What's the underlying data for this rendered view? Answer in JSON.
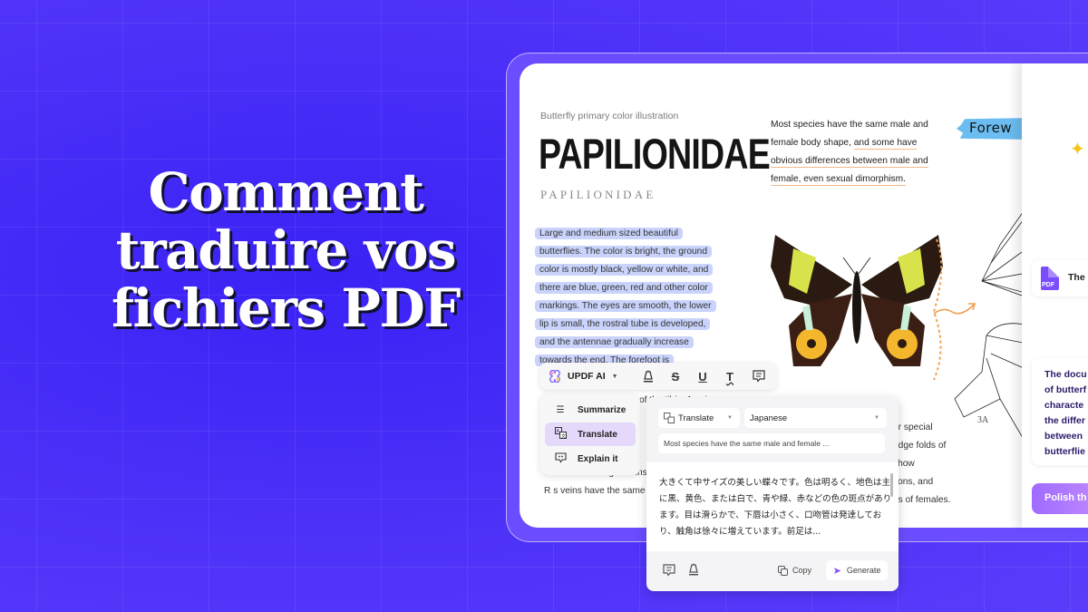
{
  "headline": {
    "lines": [
      "Comment",
      "traduire vos",
      "fichiers PDF"
    ]
  },
  "document": {
    "caption": "Butterfly primary color illustration",
    "title": "PAPILIONIDAE",
    "title_spaced": "PAPILIONIDAE",
    "left_paragraph_highlighted": [
      "Large and medium sized beautiful",
      "butterflies. The color is bright, the ground",
      "color is mostly black, yellow or white, and",
      "there are blue, green, red and other color",
      "markings. The eyes are smooth, the lower",
      "lip is small, the rostral tube is developed,",
      "and the antennae gradually increase",
      "towards the end. The forefoot is"
    ],
    "left_paragraph_partial": [
      "of the tibia; 1 pair",
      "closed. Forewing R veins",
      "R s veins have the same"
    ],
    "right_paragraph": [
      {
        "text": "Most species have the same male and",
        "underline": ""
      },
      {
        "text": "female body shape, ",
        "underline": "and some have"
      },
      {
        "text": "",
        "underline": "obvious differences between male and"
      },
      {
        "text": "",
        "underline": "female, even sexual dimorphism."
      }
    ],
    "right_paragraph_partial": [
      "or special",
      "edge folds of",
      "show",
      "sons, and",
      "es of females."
    ],
    "annotation_sticker": "Forew",
    "diagram_label": "3A"
  },
  "toolbar": {
    "ai_label": "UPDF AI",
    "tools": [
      "highlight",
      "strikethrough",
      "underline",
      "squiggly-text",
      "comment"
    ]
  },
  "ai_menu": {
    "items": [
      {
        "label": "Summarize",
        "icon": "list-icon",
        "active": false
      },
      {
        "label": "Translate",
        "icon": "translate-icon",
        "active": true
      },
      {
        "label": "Explain it",
        "icon": "explain-icon",
        "active": false
      }
    ]
  },
  "translate_popup": {
    "mode_select": "Translate",
    "language_select": "Japanese",
    "source_text": "Most species have the same male and female ...",
    "result_lines": [
      "大きくて中サイズの美しい蝶々です。色は明るく、地色は主",
      "に黒、黄色、または白で、青や緑、赤などの色の斑点があり",
      "ます。目は滑らかで、下唇は小さく、口吻管は発達してお",
      "り、触角は徐々に増えています。前足は..."
    ],
    "copy_label": "Copy",
    "generate_label": "Generate"
  },
  "ai_panel": {
    "file_name": "The I",
    "summary_lines": [
      "The docu",
      "of butterf",
      "characte",
      "the differ",
      "between",
      "butterflie"
    ],
    "polish_button": "Polish th"
  },
  "colors": {
    "background": "#4a2ff8",
    "frame": "#6b4cff",
    "highlight": "#c9d3fb",
    "menu_active": "#e5d9fb",
    "accent_purple": "#8a4dff",
    "underline_orange": "#f3b98a",
    "sticker_blue": "#6bbcf0"
  }
}
